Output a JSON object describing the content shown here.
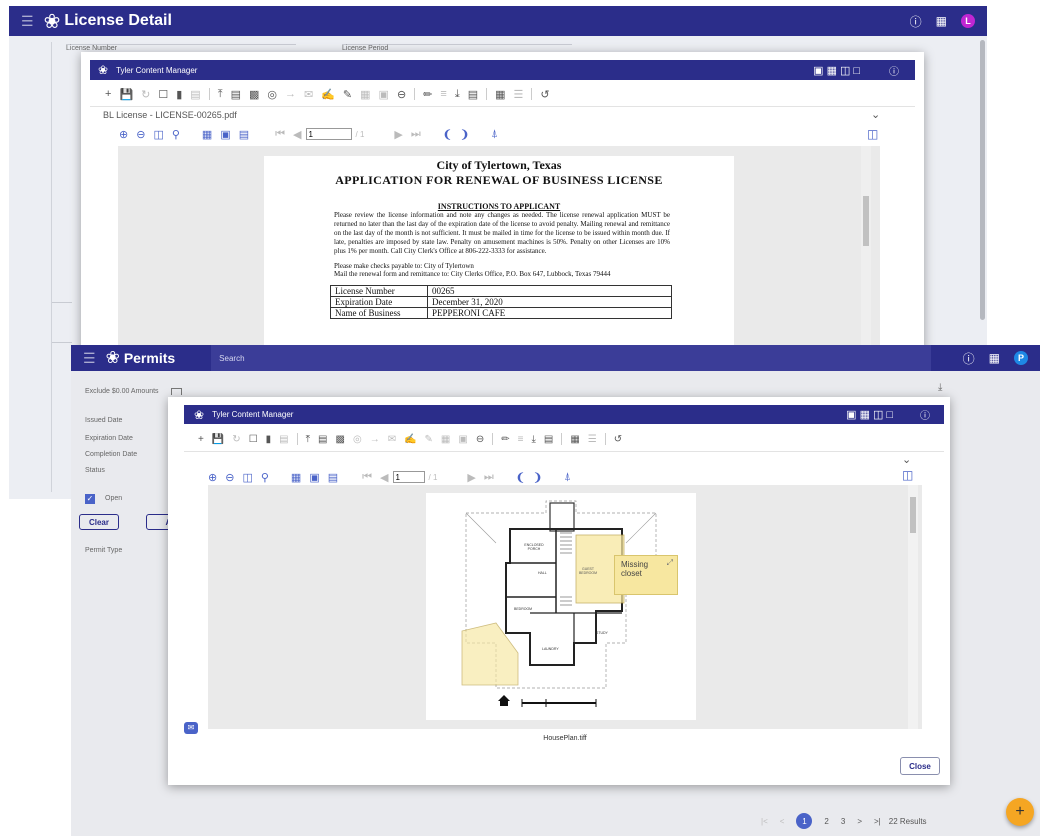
{
  "license_app": {
    "title": "License Detail",
    "field_license_number": "License Number",
    "field_license_period": "License Period"
  },
  "license_viewer": {
    "title": "Tyler Content Manager",
    "filename": "BL License - LICENSE-00265.pdf",
    "page_input": "1",
    "page_total": "/ 1"
  },
  "license_doc": {
    "city": "City of Tylertown, Texas",
    "heading": "APPLICATION FOR RENEWAL OF BUSINESS LICENSE",
    "instructions_title": "INSTRUCTIONS TO APPLICANT",
    "instructions_body": "Please review the license information and note any changes as needed. The license renewal application MUST be returned no later than the last day of the expiration date of the license to avoid penalty. Mailing renewal and remittance on the last day of the month is not sufficient. It must be mailed in time for the license to be issued within month due. If late, penalties are imposed by state law. Penalty on amusement machines is 50%. Penalty on other Licenses are 10% plus 1% per month. Call City Clerk's Office at 806-222-3333 for assistance.",
    "checks_line": "Please make checks payable to: City of Tylertown",
    "mail_line": "Mail the renewal form and remittance to: City Clerks Office, P.O. Box 647, Lubbock, Texas 79444",
    "table": [
      {
        "label": "License Number",
        "value": "00265"
      },
      {
        "label": "Expiration Date",
        "value": "December 31, 2020"
      },
      {
        "label": "Name of Business",
        "value": "PEPPERONI CAFE"
      }
    ]
  },
  "permits_app": {
    "title": "Permits",
    "search_placeholder": "Search",
    "sidebar": {
      "exclude_label": "Exclude $0.00 Amounts",
      "issued_date": "Issued Date",
      "expiration_date": "Expiration Date",
      "completion_date": "Completion Date",
      "status": "Status",
      "open_label": "Open",
      "clear_label": "Clear",
      "apply_label": "App",
      "permit_type": "Permit Type"
    }
  },
  "plan_viewer": {
    "title": "Tyler Content Manager",
    "page_input": "1",
    "page_total": "/ 1",
    "file_caption": "HousePlan.tiff",
    "close_label": "Close",
    "annotation_text": "Missing closet",
    "room_labels": {
      "enclosed_porch": "ENCLOSED PORCH",
      "hall": "HALL",
      "guest_bedroom": "GUEST BEDROOM",
      "bedroom": "BEDROOM",
      "laundry": "LAUNDRY",
      "study": "STUDY"
    }
  },
  "pagination": {
    "first": "|<",
    "prev": "<",
    "pages": [
      "1",
      "2",
      "3"
    ],
    "next": ">",
    "last": ">|",
    "results": "22 Results"
  },
  "fab_label": "+",
  "avatars": {
    "license_user": "L",
    "permits_user": "P"
  },
  "colors": {
    "app_bar": "#2b2d8a",
    "accent_blue": "#4a63c8",
    "avatar_license": "#c026d3",
    "avatar_permits": "#1e88e5",
    "fab": "#f5a623",
    "annotation_fill": "#f7e7a0"
  }
}
